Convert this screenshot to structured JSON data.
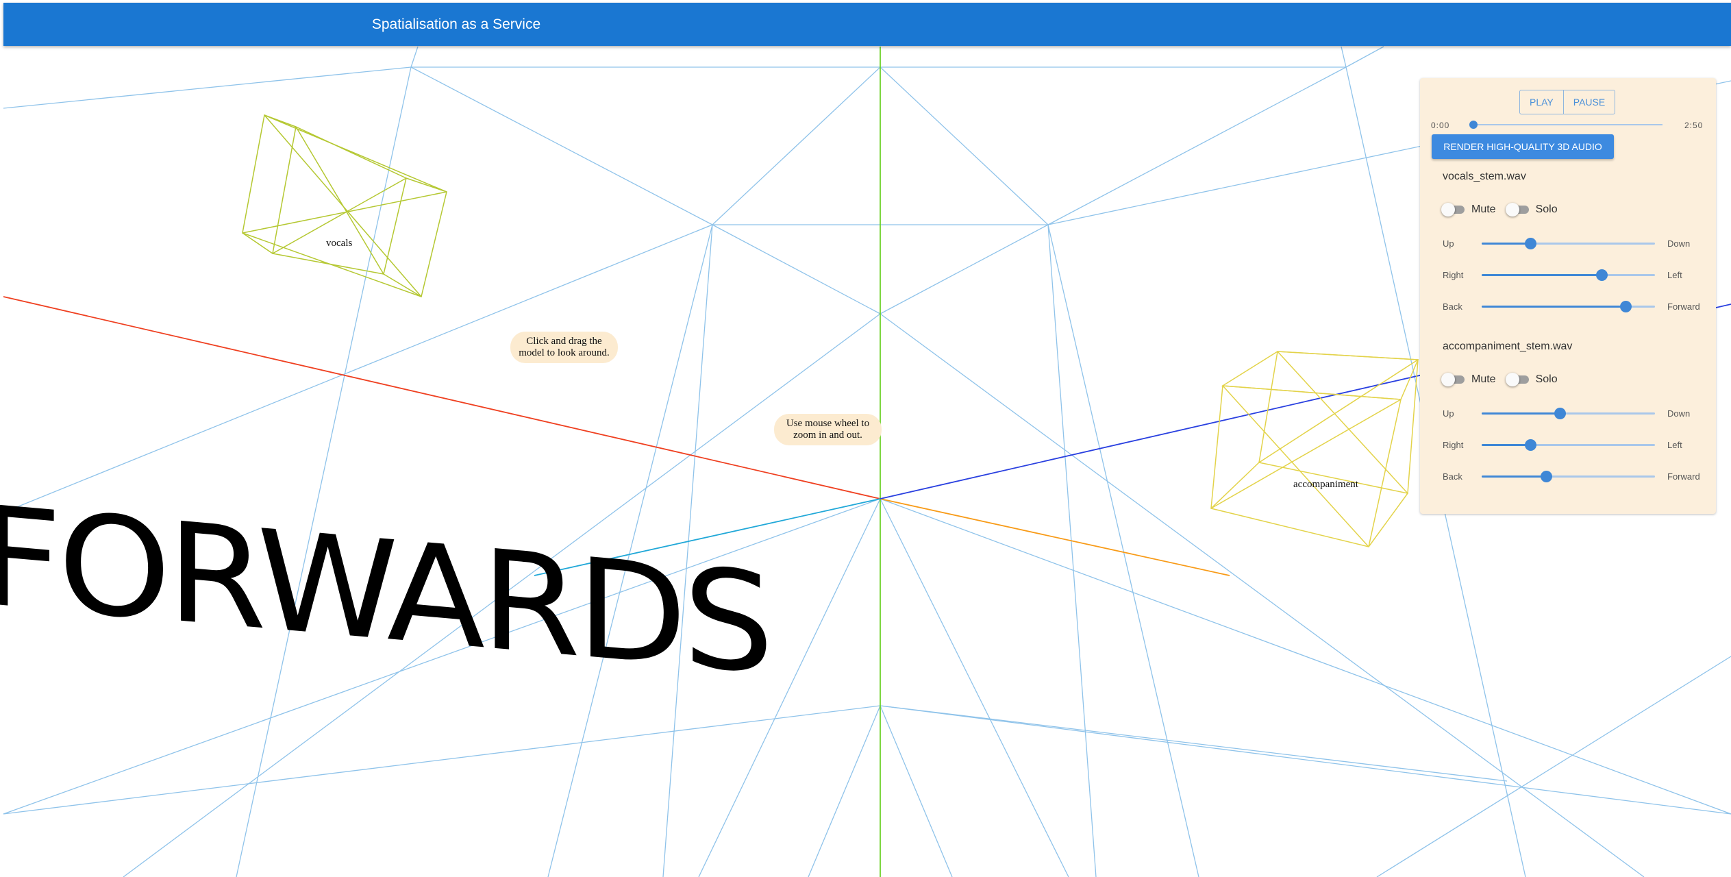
{
  "app": {
    "title": "Spatialisation as a Service"
  },
  "hints": {
    "drag": "Click and drag the model to look around.",
    "zoom": "Use mouse wheel to zoom in and out."
  },
  "scene": {
    "forward_text": "FORWARDS",
    "objects": [
      {
        "label": "vocals",
        "color": "#b5c832"
      },
      {
        "label": "accompaniment",
        "color": "#e3d34a"
      }
    ],
    "grid_color": "#8fc3ea",
    "axis_colors": {
      "x": "#f04020",
      "y": "#6ed12a",
      "z": "#2a40e0"
    }
  },
  "transport": {
    "play_label": "PLAY",
    "pause_label": "PAUSE",
    "current_time": "0:00",
    "total_time": "2:50",
    "progress": 0,
    "render_label": "RENDER HIGH-QUALITY 3D AUDIO"
  },
  "stems": [
    {
      "name": "vocals_stem.wav",
      "mute_label": "Mute",
      "solo_label": "Solo",
      "sliders": [
        {
          "left": "Up",
          "right": "Down",
          "value": 0.28
        },
        {
          "left": "Right",
          "right": "Left",
          "value": 0.69
        },
        {
          "left": "Back",
          "right": "Forward",
          "value": 0.83
        }
      ]
    },
    {
      "name": "accompaniment_stem.wav",
      "mute_label": "Mute",
      "solo_label": "Solo",
      "sliders": [
        {
          "left": "Up",
          "right": "Down",
          "value": 0.45
        },
        {
          "left": "Right",
          "right": "Left",
          "value": 0.28
        },
        {
          "left": "Back",
          "right": "Forward",
          "value": 0.37
        }
      ]
    }
  ]
}
